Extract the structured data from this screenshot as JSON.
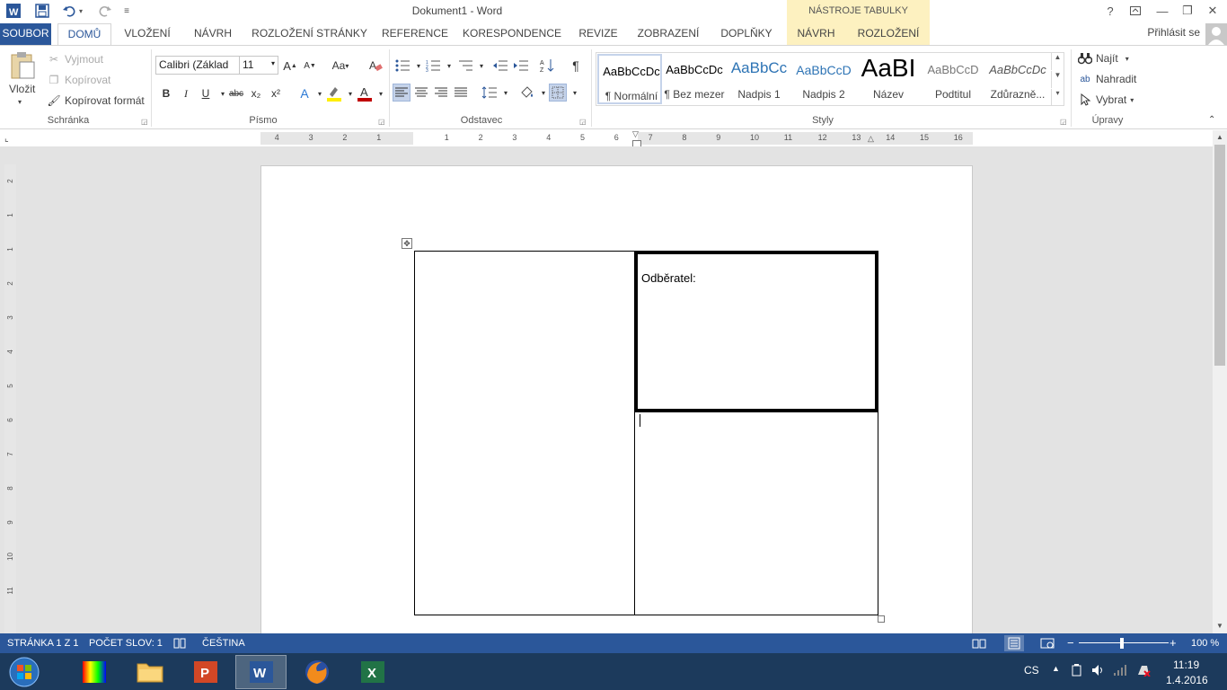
{
  "title_bar": {
    "document_title": "Dokument1 - Word",
    "tool_context_label": "NÁSTROJE TABULKY",
    "help": "?",
    "minimize": "—",
    "restore": "❐",
    "close": "✕"
  },
  "tabs": {
    "file": "SOUBOR",
    "home": "DOMŮ",
    "insert": "VLOŽENÍ",
    "design": "NÁVRH",
    "layout": "ROZLOŽENÍ STRÁNKY",
    "references": "REFERENCE",
    "mailings": "KORESPONDENCE",
    "review": "REVIZE",
    "view": "ZOBRAZENÍ",
    "addins": "DOPLŇKY",
    "table_design": "NÁVRH",
    "table_layout": "ROZLOŽENÍ",
    "sign_in": "Přihlásit se"
  },
  "clipboard": {
    "paste": "Vložit",
    "cut": "Vyjmout",
    "copy": "Kopírovat",
    "format_painter": "Kopírovat formát",
    "group": "Schránka"
  },
  "font": {
    "name": "Calibri (Základ",
    "size": "11",
    "group": "Písmo",
    "bold": "B",
    "italic": "I",
    "underline": "U",
    "strike": "abc",
    "subscript": "x₂",
    "superscript": "x²",
    "case": "Aa",
    "grow": "A",
    "shrink": "A"
  },
  "paragraph": {
    "group": "Odstavec",
    "pilcrow": "¶"
  },
  "styles": {
    "group": "Styly",
    "items": [
      {
        "preview": "AaBbCcDc",
        "name": "¶ Normální"
      },
      {
        "preview": "AaBbCcDc",
        "name": "¶ Bez mezer"
      },
      {
        "preview": "AaBbCc",
        "name": "Nadpis 1"
      },
      {
        "preview": "AaBbCcD",
        "name": "Nadpis 2"
      },
      {
        "preview": "AaBI",
        "name": "Název"
      },
      {
        "preview": "AaBbCcD",
        "name": "Podtitul"
      },
      {
        "preview": "AaBbCcDc",
        "name": "Zdůrazně..."
      }
    ]
  },
  "editing": {
    "group": "Úpravy",
    "find": "Najít",
    "replace": "Nahradit",
    "select": "Vybrat"
  },
  "ruler": {
    "h_ticks": [
      "4",
      "3",
      "2",
      "1",
      "1",
      "2",
      "3",
      "4",
      "5",
      "6",
      "7",
      "8",
      "9",
      "10",
      "11",
      "12",
      "13",
      "14",
      "15",
      "16"
    ],
    "v_ticks": [
      "2",
      "1",
      "1",
      "2",
      "3",
      "4",
      "5",
      "6",
      "7",
      "8",
      "9",
      "10",
      "11"
    ]
  },
  "document": {
    "customer_label": "Odběratel:"
  },
  "status_bar": {
    "page": "STRÁNKA 1 Z 1",
    "words": "POČET SLOV: 1",
    "language": "ČEŠTINA",
    "zoom": "100 %"
  },
  "taskbar": {
    "lang": "CS",
    "time": "11:19",
    "date": "1.4.2016"
  },
  "colors": {
    "word_blue": "#2b579a",
    "table_tools": "#fdf1c0",
    "taskbar": "#1c3a5c"
  }
}
